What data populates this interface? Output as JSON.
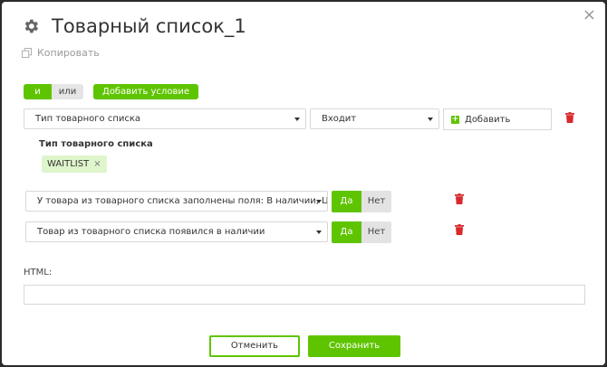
{
  "dialog": {
    "title": "Товарный список_1",
    "close_glyph": "×",
    "copy_label": "Копировать"
  },
  "logic": {
    "and_label": "и",
    "or_label": "или",
    "add_condition_label": "Добавить условие"
  },
  "condition1": {
    "type_select_value": "Тип товарного списка",
    "operator_select_value": "Входит",
    "add_label": "Добавить",
    "field_label": "Тип товарного списка",
    "tag_value": "WAITLIST",
    "tag_remove_glyph": "×"
  },
  "condition2": {
    "select_value": "У товара из товарного списка заполнены поля: В наличии, Цена,",
    "yes_label": "Да",
    "no_label": "Нет"
  },
  "condition3": {
    "select_value": "Товар из товарного списка появился в наличии",
    "yes_label": "Да",
    "no_label": "Нет"
  },
  "html_field": {
    "label": "HTML:",
    "value": ""
  },
  "footer": {
    "cancel_label": "Отменить",
    "save_label": "Сохранить"
  },
  "colors": {
    "accent": "#5fc400",
    "danger": "#d9292f",
    "tag_bg": "#dff5cc"
  },
  "icons": {
    "title_icon": "gear-icon",
    "copy_icon": "copy-icon",
    "delete_icon": "trash-icon",
    "add_icon": "plus-square-icon"
  }
}
